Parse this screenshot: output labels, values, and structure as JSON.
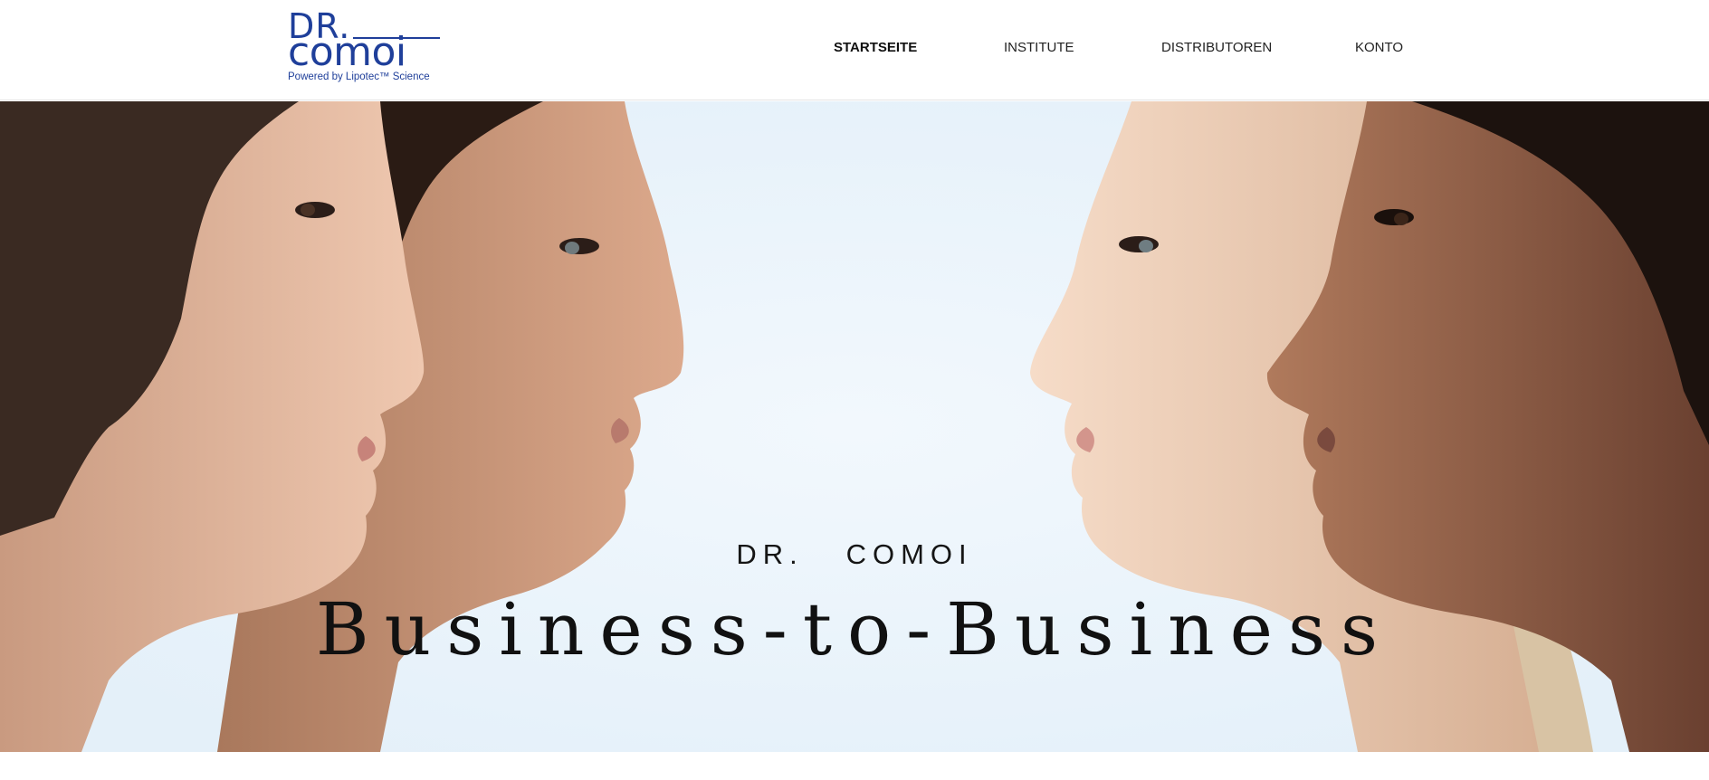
{
  "brand": {
    "logo_line1": "DR.",
    "logo_line2": "comoi",
    "logo_tagline": "Powered by Lipotec™ Science",
    "color": "#1f3f9a"
  },
  "nav": {
    "items": [
      {
        "label": "STARTSEITE",
        "active": true
      },
      {
        "label": "INSTITUTE",
        "active": false
      },
      {
        "label": "DISTRIBUTOREN",
        "active": false
      },
      {
        "label": "KONTO",
        "active": false
      }
    ]
  },
  "hero": {
    "kicker": "DR.   COMOI",
    "title": "Business-to-Business",
    "background_color": "#eaf4fb"
  }
}
